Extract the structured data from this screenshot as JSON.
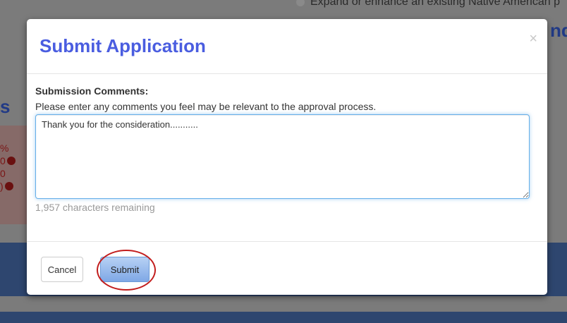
{
  "background": {
    "top_text": "Expand or enhance an existing Native American p",
    "heading_right": "nd",
    "heading_left": "s",
    "panel_lines": [
      "%",
      "0",
      "0",
      ")"
    ]
  },
  "modal": {
    "title": "Submit Application",
    "close_symbol": "×",
    "comments_label": "Submission Comments:",
    "help_text": "Please enter any comments you feel may be relevant to the approval process.",
    "comments_value": "Thank you for the consideration...........",
    "characters_remaining": "1,957 characters remaining",
    "cancel_label": "Cancel",
    "submit_label": "Submit"
  },
  "colors": {
    "title": "#4a5de0",
    "highlight_circle": "#c21d1d",
    "focus_border": "#66afe9"
  }
}
